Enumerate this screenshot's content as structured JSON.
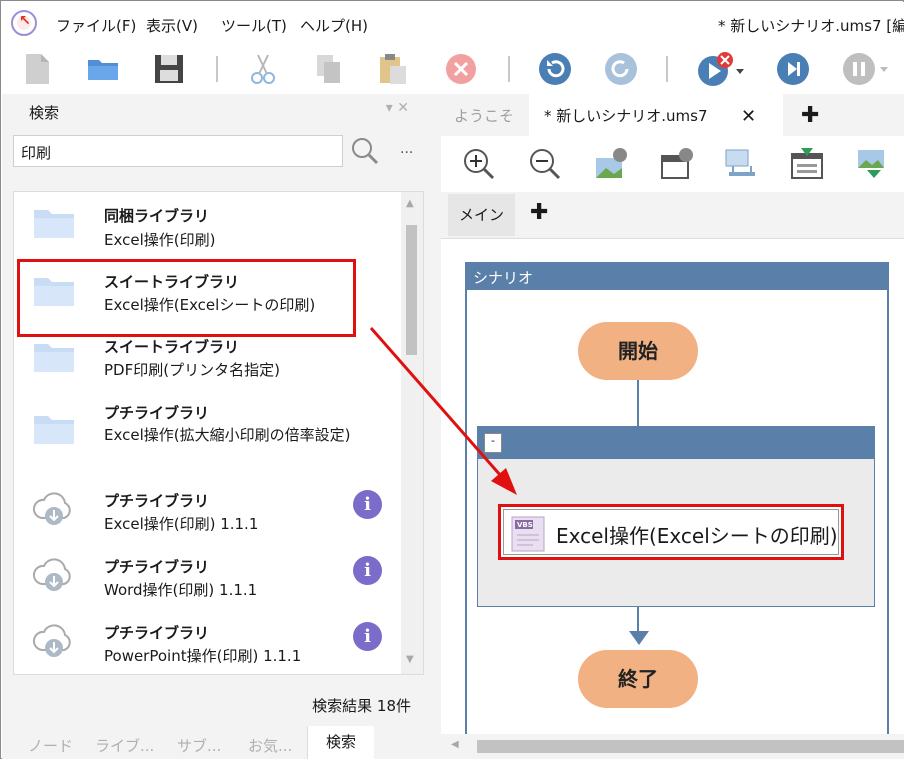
{
  "menubar": {
    "items": [
      "ファイル(F)",
      "表示(V)",
      "ツール(T)",
      "ヘルプ(H)"
    ],
    "title": "* 新しいシナリオ.ums7 [編"
  },
  "toolbar": {
    "icons": [
      "new-file-icon",
      "open-folder-icon",
      "save-icon",
      "cut-icon",
      "copy-icon",
      "paste-icon",
      "stop-icon",
      "undo-icon",
      "redo-icon",
      "run-icon",
      "step-icon",
      "pause-icon"
    ]
  },
  "search_panel": {
    "title": "検索",
    "query": "印刷",
    "more_label": "...",
    "results": [
      {
        "library": "同梱ライブラリ",
        "name": "Excel操作(印刷)",
        "icon": "folder-icon",
        "info": false
      },
      {
        "library": "スイートライブラリ",
        "name": "Excel操作(Excelシートの印刷)",
        "icon": "folder-icon",
        "info": false
      },
      {
        "library": "スイートライブラリ",
        "name": "PDF印刷(プリンタ名指定)",
        "icon": "folder-icon",
        "info": false
      },
      {
        "library": "プチライブラリ",
        "name": "Excel操作(拡大縮小印刷の倍率設定)",
        "icon": "folder-icon",
        "info": false
      },
      {
        "library": "プチライブラリ",
        "name": "Excel操作(印刷) 1.1.1",
        "icon": "cloud-download-icon",
        "info": true
      },
      {
        "library": "プチライブラリ",
        "name": "Word操作(印刷) 1.1.1",
        "icon": "cloud-download-icon",
        "info": true
      },
      {
        "library": "プチライブラリ",
        "name": "PowerPoint操作(印刷) 1.1.1",
        "icon": "cloud-download-icon",
        "info": true
      }
    ],
    "result_count": "検索結果 18件",
    "bottom_tabs": [
      "ノード",
      "ライブ...",
      "サブ...",
      "お気...",
      "検索"
    ]
  },
  "editor": {
    "tabs": [
      "ようこそ",
      "* 新しいシナリオ.ums7"
    ],
    "close_label": "✕",
    "add_label": "✚",
    "view_tabs": [
      "メイン"
    ],
    "scenario_label": "シナリオ",
    "start_label": "開始",
    "end_label": "終了",
    "collapse_label": "-",
    "action_label": "Excel操作(Excelシートの印刷)",
    "vbs_badge": "VBS"
  },
  "colors": {
    "accent_blue": "#5a7fa8",
    "terminal": "#f2b183",
    "highlight": "#e01010",
    "info": "#7b6cc9"
  }
}
